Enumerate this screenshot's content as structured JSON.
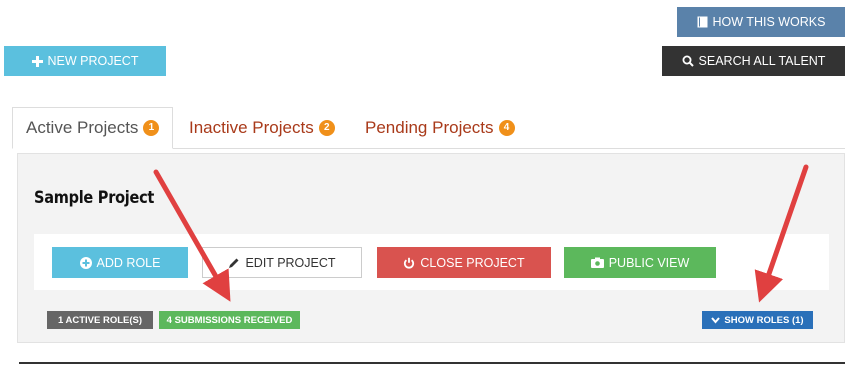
{
  "header": {
    "how_works_label": "HOW THIS WORKS",
    "new_project_label": "NEW PROJECT",
    "search_talent_label": "SEARCH ALL TALENT"
  },
  "tabs": [
    {
      "label": "Active Projects",
      "count": "1",
      "active": true
    },
    {
      "label": "Inactive Projects",
      "count": "2",
      "active": false
    },
    {
      "label": "Pending Projects",
      "count": "4",
      "active": false
    }
  ],
  "project": {
    "title": "Sample Project",
    "add_role_label": "ADD ROLE",
    "edit_project_label": "EDIT PROJECT",
    "close_project_label": "CLOSE PROJECT",
    "public_view_label": "PUBLIC VIEW",
    "active_roles_label": "1 ACTIVE ROLE(S)",
    "submissions_label": "4 SUBMISSIONS RECEIVED",
    "show_roles_label": "SHOW ROLES (1)"
  },
  "colors": {
    "info": "#5bc0de",
    "dark": "#333333",
    "steel": "#5a82aa",
    "danger": "#d9534f",
    "success": "#5cb85c",
    "primary": "#2a70b9",
    "badge": "#f0901a",
    "tab_text": "#a93a1a",
    "annotation_arrow": "#e04040"
  }
}
